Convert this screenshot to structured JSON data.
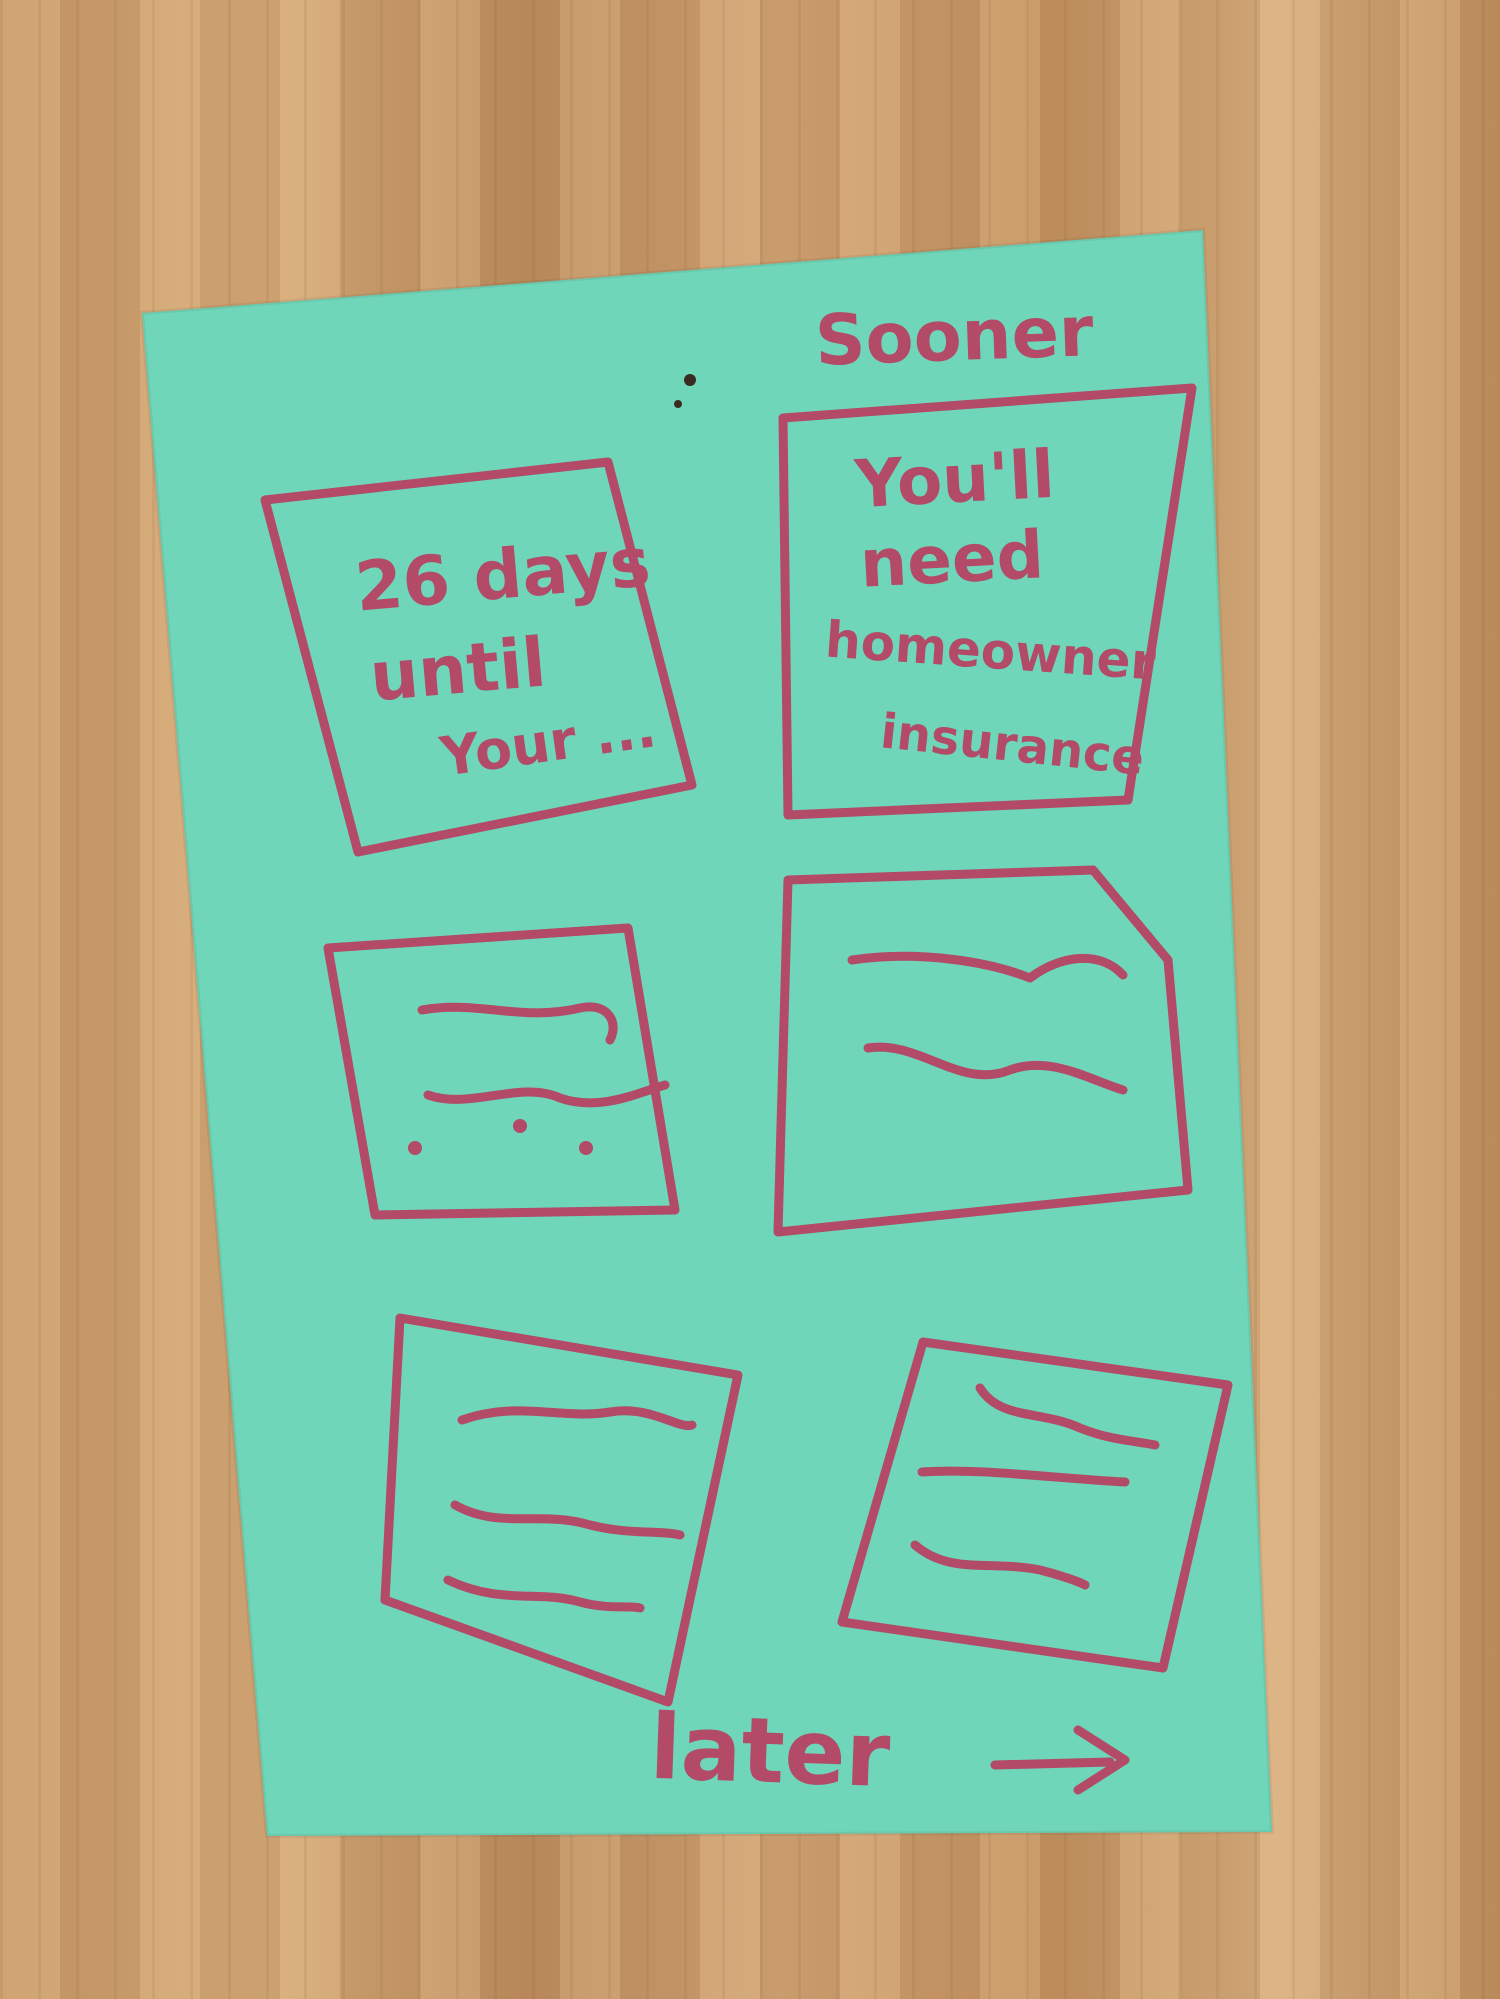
{
  "colors": {
    "wood": "#c99a68",
    "card": "#6fd6ba",
    "marker": "#b24a68"
  },
  "labels": {
    "sooner": "Sooner",
    "later": "later"
  },
  "tiles": {
    "tile1": {
      "line1": "26 days",
      "line2": "until",
      "line3": "Your ..."
    },
    "tile2": {
      "line1": "You'll",
      "line2": "need",
      "line3": "homeowner",
      "line4": "insurance"
    }
  },
  "icons": {
    "later_arrow": "right-arrow-icon"
  }
}
